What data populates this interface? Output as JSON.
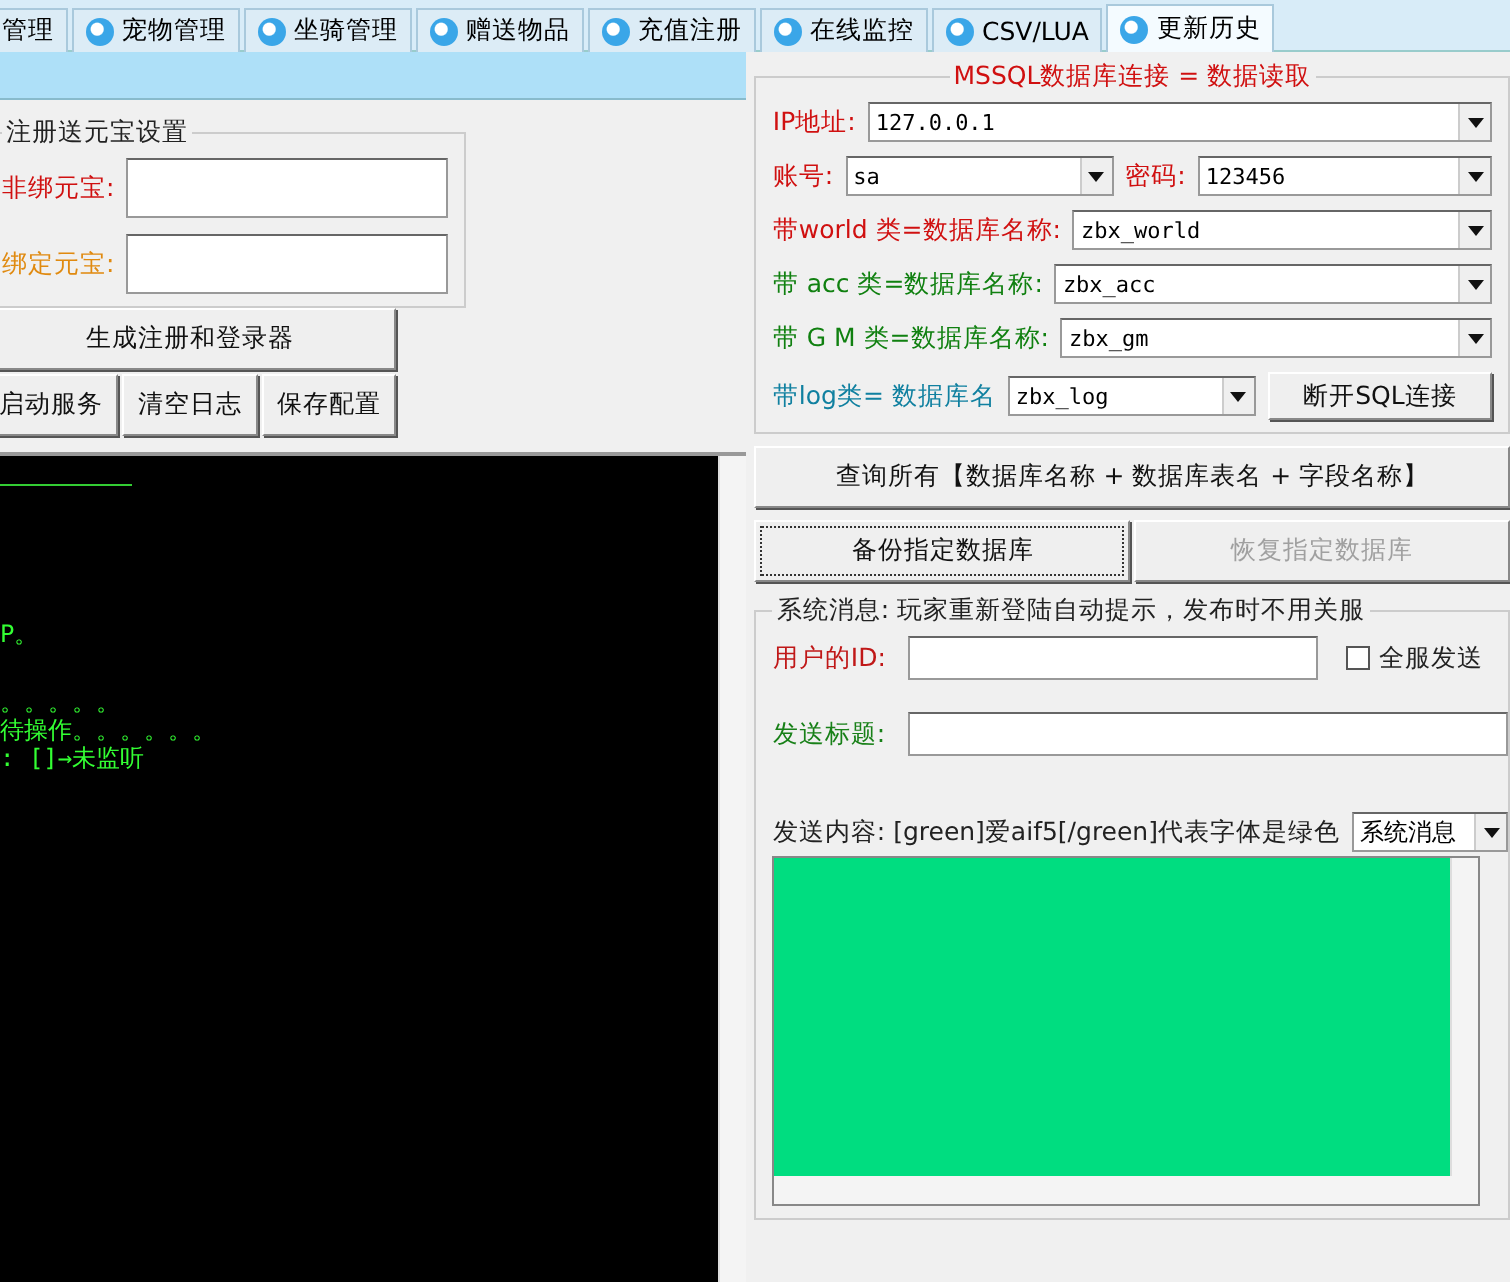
{
  "tabs": [
    {
      "label": "管理",
      "selected": false
    },
    {
      "label": "宠物管理",
      "selected": false
    },
    {
      "label": "坐骑管理",
      "selected": false
    },
    {
      "label": "赠送物品",
      "selected": false
    },
    {
      "label": "充值注册",
      "selected": false
    },
    {
      "label": "在线监控",
      "selected": false
    },
    {
      "label": "CSV/LUA",
      "selected": false
    },
    {
      "label": "更新历史",
      "selected": true
    }
  ],
  "reward_group": {
    "title": "注册送元宝设置",
    "fields": [
      {
        "label": "非绑元宝:",
        "color": "#d01010"
      },
      {
        "label": "绑定元宝:",
        "color": "#e08a10"
      }
    ]
  },
  "generate_button": "生成注册和登录器",
  "action_buttons": [
    "启动服务",
    "清空日志",
    "保存配置"
  ],
  "log_lines": [
    "P。",
    "。。。。。",
    "待操作。。。。。。",
    ": []→未监听"
  ],
  "sql_group": {
    "title": "MSSQL数据库连接 = 数据读取",
    "rows": [
      {
        "kind": "full",
        "label": "IP地址:",
        "value": "127.0.0.1",
        "color": "#d01010"
      },
      {
        "kind": "pair",
        "label": "账号:",
        "value": "sa",
        "label2": "密码:",
        "value2": "123456",
        "color": "#d01010"
      },
      {
        "kind": "full",
        "label": "带world 类=数据库名称:",
        "value": "zbx_world",
        "color": "#d01010"
      },
      {
        "kind": "full",
        "label": "带 acc  类=数据库名称:",
        "value": "zbx_acc",
        "color": "#108010"
      },
      {
        "kind": "full",
        "label": "带 G M  类=数据库名称:",
        "value": "zbx_gm",
        "color": "#108010"
      },
      {
        "kind": "button",
        "label": "带log类= 数据库名",
        "value": "zbx_log",
        "button": "断开SQL连接",
        "color": "#1080a0"
      }
    ]
  },
  "query_button": "查询所有【数据库名称 + 数据库表名 + 字段名称】",
  "db_buttons": [
    {
      "label": "备份指定数据库",
      "disabled": false
    },
    {
      "label": "恢复指定数据库",
      "disabled": true
    }
  ],
  "message_group": {
    "title": "系统消息:  玩家重新登陆自动提示，发布时不用关服",
    "user_id_label": "用户的ID:",
    "broadcast": {
      "label": "全服发送",
      "checked": false
    },
    "subject_label": "发送标题:",
    "content_label": "发送内容: [green]爱aif5[/green]代表字体是绿色",
    "type_select": "系统消息"
  }
}
